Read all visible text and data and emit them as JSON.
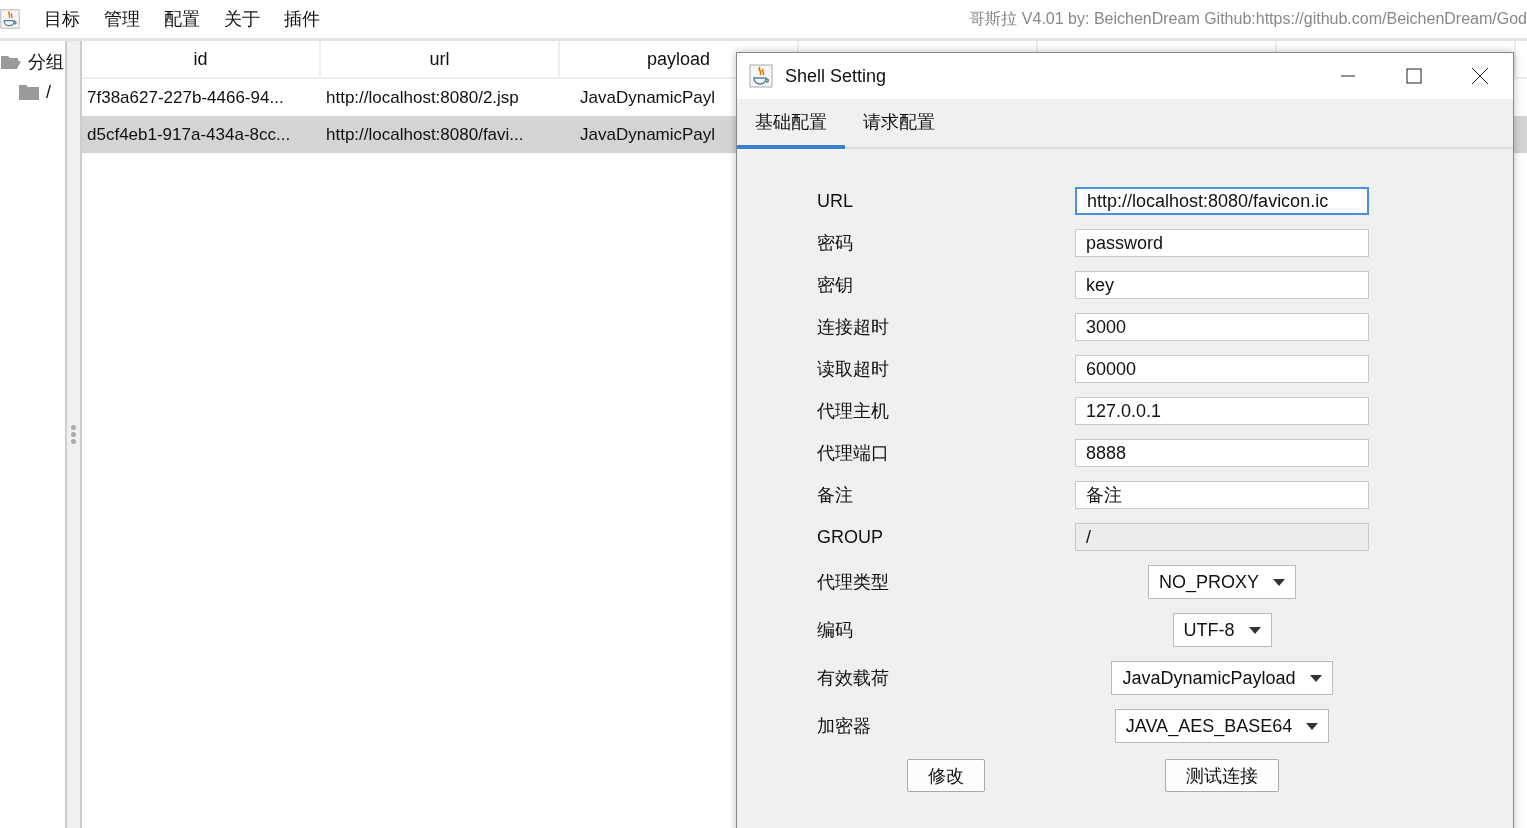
{
  "menu_bar": {
    "items": [
      "目标",
      "管理",
      "配置",
      "关于",
      "插件"
    ],
    "title": "哥斯拉   V4.01 by: BeichenDream Github:https://github.com/BeichenDream/God"
  },
  "tree": [
    {
      "label": "分组",
      "expanded": true,
      "children": [
        {
          "label": "/"
        }
      ]
    }
  ],
  "table": {
    "columns": [
      "id",
      "url",
      "payload"
    ],
    "rows": [
      {
        "cells": [
          "7f38a627-227b-4466-94...",
          "http://localhost:8080/2.jsp",
          "JavaDynamicPayl"
        ],
        "selected": false
      },
      {
        "cells": [
          "d5cf4eb1-917a-434a-8cc...",
          "http://localhost:8080/favi...",
          "JavaDynamicPayl"
        ],
        "selected": true
      }
    ]
  },
  "dialog": {
    "title": "Shell Setting",
    "tabs": [
      {
        "label": "基础配置",
        "selected": true
      },
      {
        "label": "请求配置",
        "selected": false
      }
    ],
    "fields": [
      {
        "kind": "text",
        "label": "URL",
        "value": "http://localhost:8080/favicon.ic",
        "focused": true,
        "disabled": false
      },
      {
        "kind": "text",
        "label": "密码",
        "value": "password",
        "focused": false,
        "disabled": false
      },
      {
        "kind": "text",
        "label": "密钥",
        "value": "key",
        "focused": false,
        "disabled": false
      },
      {
        "kind": "text",
        "label": "连接超时",
        "value": "3000",
        "focused": false,
        "disabled": false
      },
      {
        "kind": "text",
        "label": "读取超时",
        "value": "60000",
        "focused": false,
        "disabled": false
      },
      {
        "kind": "text",
        "label": "代理主机",
        "value": "127.0.0.1",
        "focused": false,
        "disabled": false
      },
      {
        "kind": "text",
        "label": "代理端口",
        "value": "8888",
        "focused": false,
        "disabled": false
      },
      {
        "kind": "text",
        "label": "备注",
        "value": "备注",
        "focused": false,
        "disabled": false
      },
      {
        "kind": "text",
        "label": "GROUP",
        "value": "/",
        "focused": false,
        "disabled": true
      },
      {
        "kind": "select",
        "label": "代理类型",
        "value": "NO_PROXY"
      },
      {
        "kind": "select",
        "label": "编码",
        "value": "UTF-8"
      },
      {
        "kind": "select",
        "label": "有效载荷",
        "value": "JavaDynamicPayload"
      },
      {
        "kind": "select",
        "label": "加密器",
        "value": "JAVA_AES_BASE64"
      }
    ],
    "buttons": [
      "修改",
      "测试连接"
    ]
  }
}
